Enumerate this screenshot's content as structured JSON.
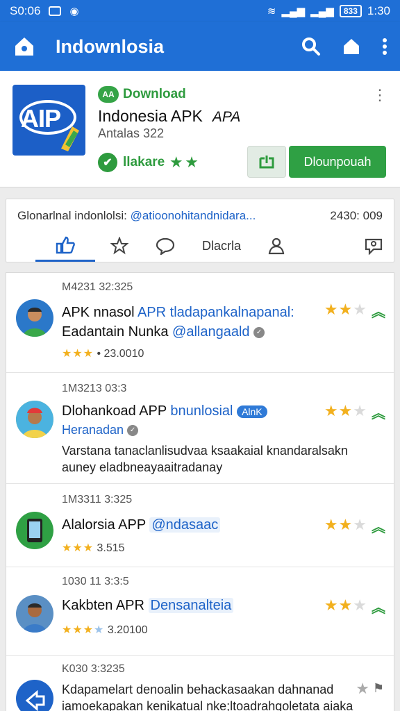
{
  "status_bar": {
    "time_left": "S0:06",
    "time_right": "1:30",
    "battery": "833"
  },
  "app_bar": {
    "title": "Indownlosia",
    "icons": [
      "home-icon",
      "search-icon",
      "house-icon",
      "more-vert-icon"
    ]
  },
  "app_card": {
    "download_label": "Download",
    "badge_text": "AA",
    "title": "Indonesia APK",
    "title_scribble": "APA",
    "subtitle": "Antalas 322",
    "rating_text": "llakare",
    "rating_stars": "★ ★",
    "download_button": "Dlounpouah",
    "logo_text": "AIP"
  },
  "tab_card": {
    "header_left": "Glonarlnal indonlolsi:",
    "header_handle": "@atioonohitandnidara...",
    "header_right": "2430: 009",
    "tabs": [
      {
        "name": "tab-like",
        "icon": "thumbs-up-icon"
      },
      {
        "name": "tab-favorite",
        "icon": "star-icon"
      },
      {
        "name": "tab-comments",
        "icon": "speech-bubble-icon"
      },
      {
        "name": "tab-text",
        "label": "Dlacrla"
      },
      {
        "name": "tab-profile",
        "icon": "person-icon"
      },
      {
        "name": "tab-chat",
        "icon": "chat-icon"
      }
    ]
  },
  "reviews": [
    {
      "date": "M4231 32:325",
      "line1_a": "APK nnasol ",
      "line1_b": "APR tladapankalnapanal:",
      "line2_a": "Eadantain Nunka ",
      "line2_b": "@allangaald",
      "meta_stars": "★★★",
      "meta_off": "",
      "meta_text": "• 23.0010",
      "rating": 2
    },
    {
      "date": "1M3213 03:3",
      "line1_a": "Dlohankoad APP ",
      "line1_b": "bnunlosial",
      "chip": "AlnK",
      "line2_a": "",
      "line2_b": "Heranadan",
      "line3": "Varstana tanaclanlisudvaa ksaakaial knandaralsakn",
      "line4": "auney eladbneayaaitradanay",
      "rating": 2
    },
    {
      "date": "1M3311 3:325",
      "line1_a": "Alalorsia APP ",
      "line1_b": "@ndasaac",
      "meta_stars": "★★★",
      "meta_off": "",
      "meta_text": "3.515",
      "rating": 2
    },
    {
      "date": "1030 11 3:3:5",
      "line1_a": "Kakbten APR ",
      "line1_b": "Densanalteia",
      "meta_stars": "★★★",
      "meta_off": "★",
      "meta_text": "3.20100",
      "rating": 2
    },
    {
      "date": "K030 3:3235",
      "line1_a": "Kdapamelart denoalin behackasaakan dahnanad",
      "line2_a": "iamoekapakan kenikatual nke;ltoadrahqoletata aiaka",
      "rating": 1
    }
  ],
  "colors": {
    "primary": "#1f6fd6",
    "green": "#2fa044",
    "star": "#f2b01e"
  }
}
